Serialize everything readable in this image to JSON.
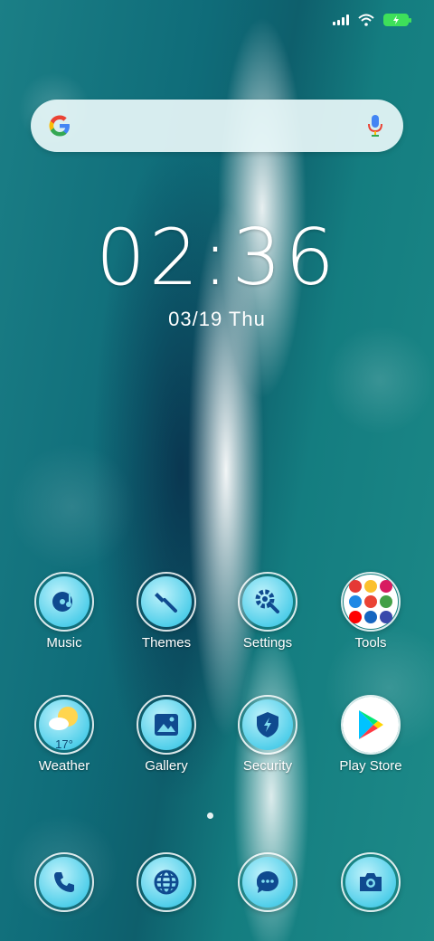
{
  "status_bar": {
    "signal_icon": "signal-bars-icon",
    "wifi_icon": "wifi-icon",
    "battery_icon": "battery-charging-icon",
    "battery_color": "#3ee05a"
  },
  "search": {
    "logo_icon": "google-g-icon",
    "mic_icon": "microphone-icon"
  },
  "clock": {
    "time": "02:36",
    "date": "03/19 Thu"
  },
  "apps": [
    {
      "label": "Music",
      "icon": "music-disc-icon"
    },
    {
      "label": "Themes",
      "icon": "paintbrush-icon"
    },
    {
      "label": "Settings",
      "icon": "gear-wrench-icon"
    },
    {
      "label": "Tools",
      "icon": "tools-folder-icon"
    },
    {
      "label": "Weather",
      "icon": "weather-sun-cloud-icon",
      "temp": "17°"
    },
    {
      "label": "Gallery",
      "icon": "image-icon"
    },
    {
      "label": "Security",
      "icon": "shield-bolt-icon"
    },
    {
      "label": "Play Store",
      "icon": "play-store-icon"
    }
  ],
  "dock": [
    {
      "icon": "phone-icon"
    },
    {
      "icon": "globe-icon"
    },
    {
      "icon": "message-icon"
    },
    {
      "icon": "camera-icon"
    }
  ],
  "colors": {
    "icon_fill": "#52cfea",
    "icon_glyph": "#0f4a8f"
  }
}
